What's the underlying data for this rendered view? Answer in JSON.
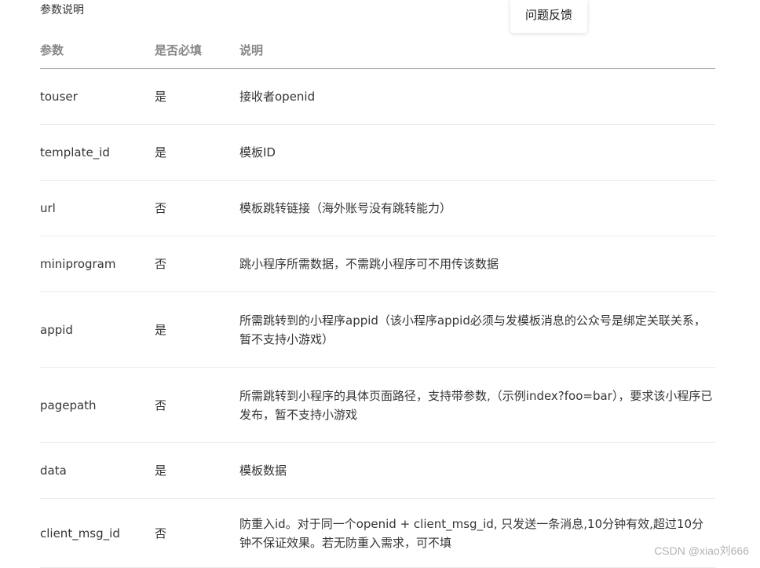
{
  "section_title": "参数说明",
  "feedback_label": "问题反馈",
  "table": {
    "headers": [
      "参数",
      "是否必填",
      "说明"
    ],
    "rows": [
      {
        "param": "touser",
        "required": "是",
        "desc": "接收者openid"
      },
      {
        "param": "template_id",
        "required": "是",
        "desc": "模板ID"
      },
      {
        "param": "url",
        "required": "否",
        "desc": "模板跳转链接（海外账号没有跳转能力）"
      },
      {
        "param": "miniprogram",
        "required": "否",
        "desc": "跳小程序所需数据，不需跳小程序可不用传该数据"
      },
      {
        "param": "appid",
        "required": "是",
        "desc": "所需跳转到的小程序appid（该小程序appid必须与发模板消息的公众号是绑定关联关系，暂不支持小游戏）"
      },
      {
        "param": "pagepath",
        "required": "否",
        "desc": "所需跳转到小程序的具体页面路径，支持带参数,（示例index?foo=bar），要求该小程序已发布，暂不支持小游戏"
      },
      {
        "param": "data",
        "required": "是",
        "desc": "模板数据"
      },
      {
        "param": "client_msg_id",
        "required": "否",
        "desc": "防重入id。对于同一个openid + client_msg_id, 只发送一条消息,10分钟有效,超过10分钟不保证效果。若无防重入需求，可不填"
      }
    ]
  },
  "watermark": "CSDN @xiao刘666"
}
